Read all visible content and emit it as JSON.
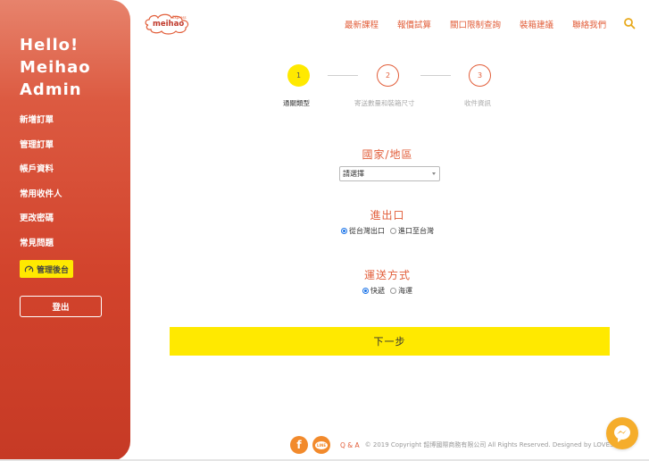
{
  "sidebar": {
    "greeting": [
      "Hello!",
      "Meihao",
      "Admin"
    ],
    "items": [
      {
        "label": "新增訂單"
      },
      {
        "label": "管理訂單"
      },
      {
        "label": "帳戶資料"
      },
      {
        "label": "常用收件人"
      },
      {
        "label": "更改密碼"
      },
      {
        "label": "常見問題"
      }
    ],
    "admin_label": "管理後台",
    "logout_label": "登出"
  },
  "header": {
    "logo_text": "meihao",
    "logo_sub": "Express",
    "nav": [
      "最新課程",
      "報價試算",
      "關口限制查詢",
      "裝箱建議",
      "聯絡我們"
    ]
  },
  "steps": [
    {
      "number": "1",
      "label": "通關類型",
      "active": true
    },
    {
      "number": "2",
      "label": "寄送數量和裝箱尺寸",
      "active": false
    },
    {
      "number": "3",
      "label": "收件資訊",
      "active": false
    }
  ],
  "form": {
    "country_title": "國家/地區",
    "country_select": "請選擇",
    "io_title": "進出口",
    "io_options": [
      {
        "label": "從台灣出口",
        "selected": true
      },
      {
        "label": "進口至台灣",
        "selected": false
      }
    ],
    "ship_title": "運送方式",
    "ship_options": [
      {
        "label": "快遞",
        "selected": true
      },
      {
        "label": "海運",
        "selected": false
      }
    ],
    "next_label": "下一步"
  },
  "footer": {
    "qa": "Q & A",
    "copyright": "© 2019 Copyright 韶博國際商務有限公司 All Rights Reserved. Designed by LOVESIT"
  },
  "colors": {
    "accent": "#e25e3a",
    "highlight": "#ffe900",
    "sidebar": "#d2432c"
  }
}
